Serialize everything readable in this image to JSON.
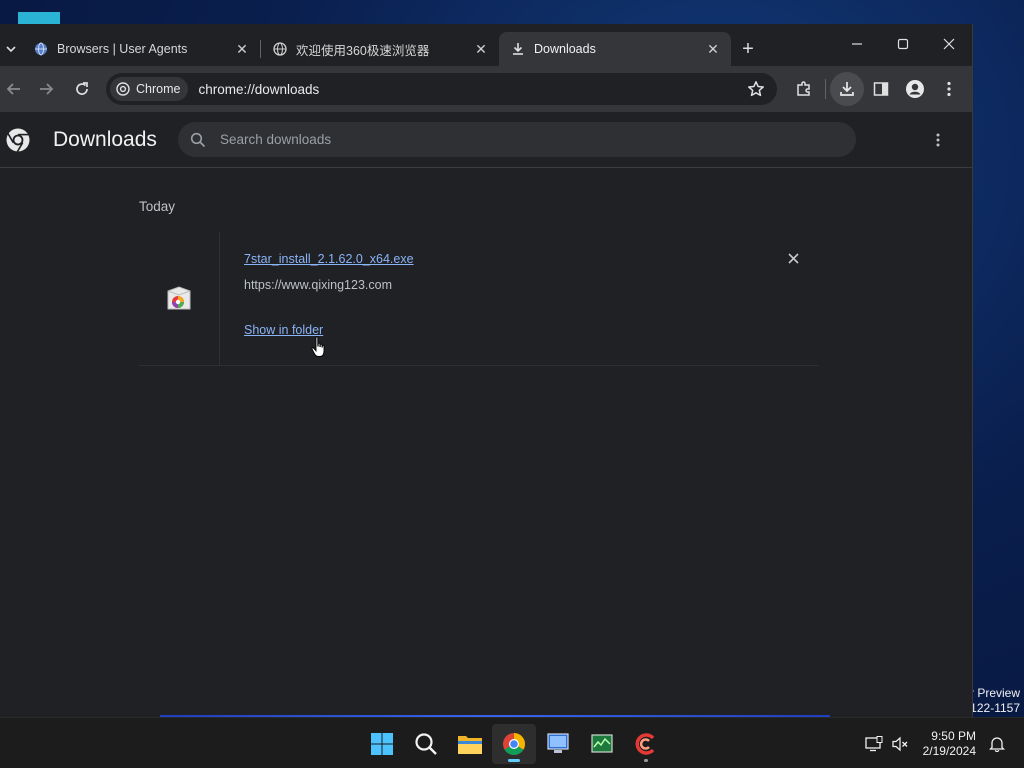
{
  "desktop": {
    "watermark": [
      "r Preview",
      "122-1157"
    ]
  },
  "tabs": [
    {
      "label": "Browsers | User Agents",
      "icon": "globe-icon"
    },
    {
      "label": "欢迎使用360极速浏览器",
      "icon": "globe-icon"
    },
    {
      "label": "Downloads",
      "icon": "download-icon",
      "active": true
    }
  ],
  "omnibox": {
    "chip_label": "Chrome",
    "url": "chrome://downloads"
  },
  "page": {
    "title": "Downloads",
    "search_placeholder": "Search downloads",
    "date_group": "Today",
    "item": {
      "file_name": "7star_install_2.1.62.0_x64.exe",
      "source_url": "https://www.qixing123.com",
      "action_label": "Show in folder"
    }
  },
  "taskbar": {
    "apps": [
      "windows-start",
      "search",
      "file-explorer",
      "chrome",
      "remote-desktop",
      "task-manager",
      "ccleaner"
    ],
    "time": "9:50 PM",
    "date": "2/19/2024"
  },
  "colors": {
    "link": "#8ab4f8",
    "background": "#202124",
    "toolbar": "#35363a",
    "accent": "#60cdff"
  }
}
